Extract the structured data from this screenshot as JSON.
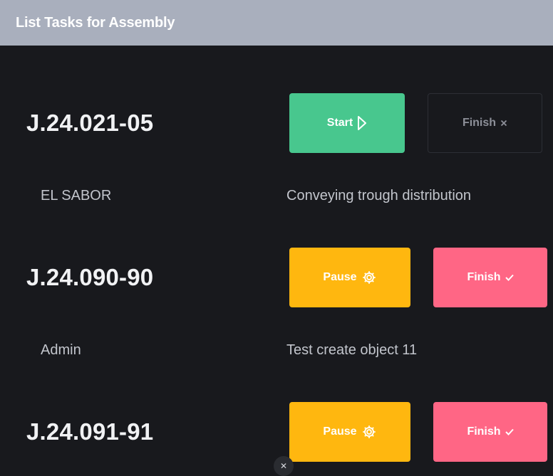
{
  "header": {
    "title": "List Tasks for Assembly"
  },
  "tasks": [
    {
      "code": "J.24.021-05",
      "customer": "EL SABOR",
      "description": "Conveying trough distribution",
      "primary_button": {
        "label": "Start",
        "icon": "play-icon"
      },
      "finish_button": {
        "label": "Finish",
        "icon": "close-icon"
      }
    },
    {
      "code": "J.24.090-90",
      "customer": "Admin",
      "description": "Test create object 11",
      "primary_button": {
        "label": "Pause",
        "icon": "gear-icon"
      },
      "finish_button": {
        "label": "Finish",
        "icon": "check-icon"
      }
    },
    {
      "code": "J.24.091-91",
      "primary_button": {
        "label": "Pause",
        "icon": "gear-icon"
      },
      "finish_button": {
        "label": "Finish",
        "icon": "check-icon"
      }
    }
  ],
  "colors": {
    "header_bg": "#a9afbd",
    "page_bg": "#18191d",
    "start": "#48c78e",
    "pause": "#ffb70f",
    "finish": "#ff6685"
  }
}
